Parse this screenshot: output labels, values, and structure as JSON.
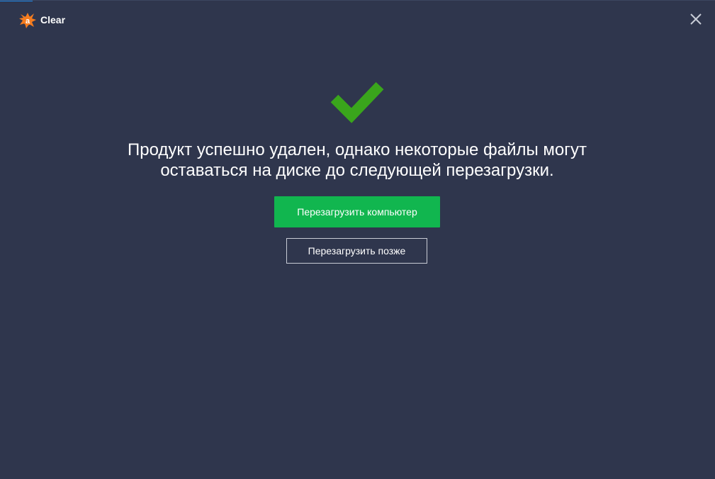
{
  "window": {
    "title": "Clear",
    "logo_icon": "avast-logo-icon",
    "close_icon": "close-icon"
  },
  "status": {
    "icon": "checkmark-icon",
    "message_line1": "Продукт успешно удален, однако некоторые файлы могут",
    "message_line2": "оставаться на диске до следующей перезагрузки."
  },
  "actions": {
    "restart_now_label": "Перезагрузить компьютер",
    "restart_later_label": "Перезагрузить позже"
  },
  "colors": {
    "background": "#2f364d",
    "primary_button": "#11b64f",
    "checkmark": "#3aa51c",
    "logo": "#f57c1f"
  }
}
